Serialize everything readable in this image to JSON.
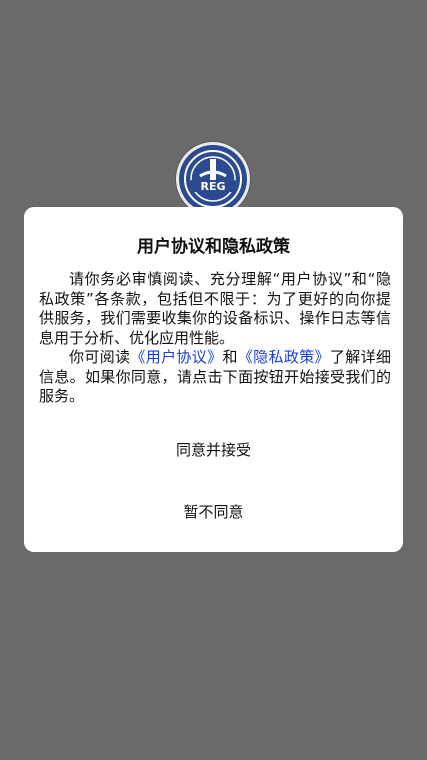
{
  "app_logo": {
    "icon": "china-railway-logo-icon",
    "brand_text": "REG",
    "colors": {
      "ring": "#2b4a8f",
      "center": "#e9ecef"
    }
  },
  "dialog": {
    "title": "用户协议和隐私政策",
    "paragraph1": "请你务必审慎阅读、充分理解“用户协议”和“隐私政策”各条款，包括但不限于：为了更好的向你提供服务，我们需要收集你的设备标识、操作日志等信息用于分析、优化应用性能。",
    "paragraph2_prefix": "你可阅读",
    "user_agreement_link": "《用户协议》",
    "paragraph2_and": "和",
    "privacy_policy_link": "《隐私政策》",
    "paragraph2_suffix": "了解详细信息。如果你同意，请点击下面按钮开始接受我们的服务。",
    "accept_button": "同意并接受",
    "reject_button": "暂不同意"
  },
  "colors": {
    "overlay": "#6a6a6a",
    "dialog_bg": "#ffffff",
    "link": "#1a3fd6",
    "text": "#111111"
  }
}
